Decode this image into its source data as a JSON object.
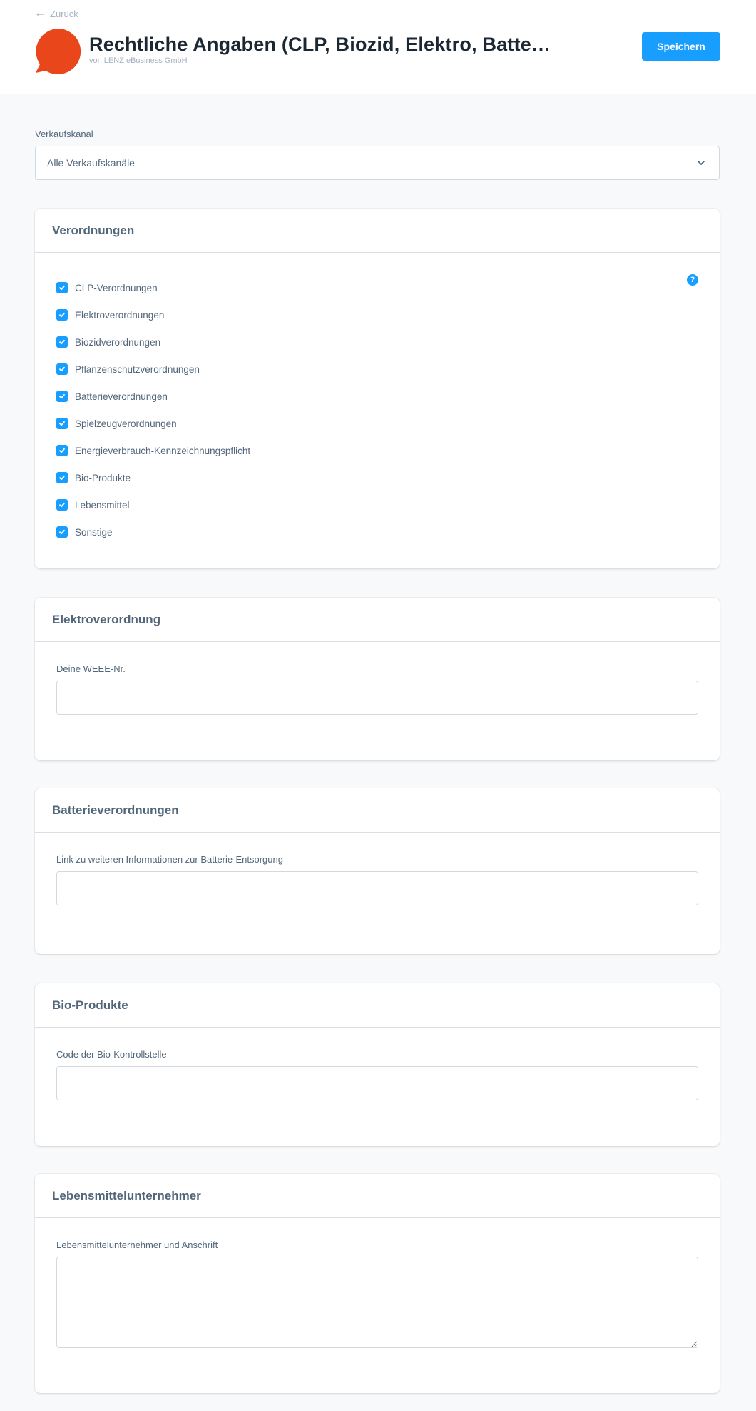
{
  "header": {
    "back_label": "Zurück",
    "title": "Rechtliche Angaben (CLP, Biozid, Elektro, Batte…",
    "subtitle": "von LENZ eBusiness GmbH",
    "save_label": "Speichern"
  },
  "channel": {
    "label": "Verkaufskanal",
    "value": "Alle Verkaufskanäle"
  },
  "regulations": {
    "title": "Verordnungen",
    "help_glyph": "?",
    "items": [
      {
        "label": "CLP-Verordnungen",
        "checked": true
      },
      {
        "label": "Elektroverordnungen",
        "checked": true
      },
      {
        "label": "Biozidverordnungen",
        "checked": true
      },
      {
        "label": "Pflanzenschutzverordnungen",
        "checked": true
      },
      {
        "label": "Batterieverordnungen",
        "checked": true
      },
      {
        "label": "Spielzeugverordnungen",
        "checked": true
      },
      {
        "label": "Energieverbrauch-Kennzeichnungspflicht",
        "checked": true
      },
      {
        "label": "Bio-Produkte",
        "checked": true
      },
      {
        "label": "Lebensmittel",
        "checked": true
      },
      {
        "label": "Sonstige",
        "checked": true
      }
    ]
  },
  "electro": {
    "title": "Elektroverordnung",
    "field_label": "Deine WEEE-Nr.",
    "value": ""
  },
  "battery": {
    "title": "Batterieverordnungen",
    "field_label": "Link zu weiteren Informationen zur Batterie-Entsorgung",
    "value": ""
  },
  "bio": {
    "title": "Bio-Produkte",
    "field_label": "Code der Bio-Kontrollstelle",
    "value": ""
  },
  "food": {
    "title": "Lebensmittelunternehmer",
    "field_label": "Lebensmittelunternehmer und Anschrift",
    "value": ""
  },
  "colors": {
    "accent": "#189eff",
    "app_icon": "#e9461c",
    "title": "#1b2733",
    "text": "#52667a",
    "muted": "#a3b3c2",
    "background": "#f8f9fb"
  },
  "icons": {
    "back": "arrow-left-icon",
    "app": "speech-bubble-icon",
    "select": "chevron-down-icon",
    "checkbox": "checkmark-icon",
    "help": "question-circle-icon"
  }
}
